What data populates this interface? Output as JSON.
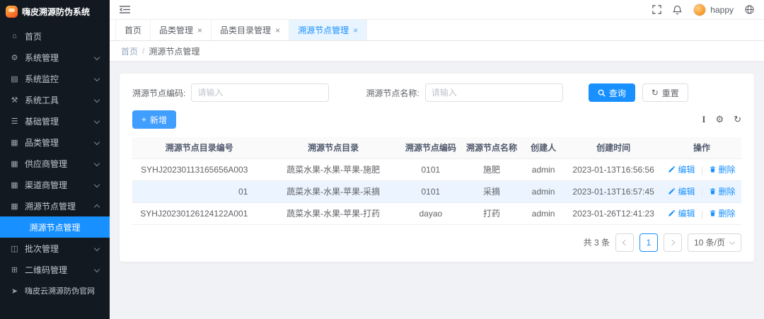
{
  "app": {
    "title": "嗨皮溯源防伪系统",
    "accent_color": "#1890ff",
    "sidebar_bg": "#131920"
  },
  "topbar": {
    "username": "happy"
  },
  "icons": {
    "plus": "+",
    "gear": "⚙",
    "refresh": "↻",
    "size": "I",
    "close": "×"
  },
  "sidebar": {
    "items": [
      {
        "label": "首页",
        "icon": "home-icon",
        "glyph": "⌂"
      },
      {
        "label": "系统管理",
        "icon": "gear-icon",
        "glyph": "⚙"
      },
      {
        "label": "系统监控",
        "icon": "monitor-icon",
        "glyph": "▤"
      },
      {
        "label": "系统工具",
        "icon": "tools-icon",
        "glyph": "⚒"
      },
      {
        "label": "基础管理",
        "icon": "list-icon",
        "glyph": "☰"
      },
      {
        "label": "品类管理",
        "icon": "grid-icon",
        "glyph": "▦"
      },
      {
        "label": "供应商管理",
        "icon": "grid-icon",
        "glyph": "▦"
      },
      {
        "label": "渠道商管理",
        "icon": "grid-icon",
        "glyph": "▦"
      },
      {
        "label": "溯源节点管理",
        "icon": "grid-icon",
        "glyph": "▦",
        "children": [
          {
            "label": "溯源节点管理"
          }
        ]
      },
      {
        "label": "批次管理",
        "icon": "batch-icon",
        "glyph": "◫"
      },
      {
        "label": "二维码管理",
        "icon": "qrcode-icon",
        "glyph": "⊞"
      },
      {
        "label": "嗨皮云溯源防伪官网",
        "icon": "send-icon",
        "glyph": "➤"
      }
    ]
  },
  "tabs": [
    {
      "label": "首页"
    },
    {
      "label": "品类管理"
    },
    {
      "label": "品类目录管理"
    },
    {
      "label": "溯源节点管理"
    }
  ],
  "breadcrumb": {
    "first": "首页",
    "separator": "/",
    "last": "溯源节点管理"
  },
  "search": {
    "code_label": "溯源节点编码:",
    "code_placeholder": "请输入",
    "name_label": "溯源节点名称:",
    "name_placeholder": "请输入",
    "search_button": "查询",
    "reset_button": "重置"
  },
  "toolbar": {
    "add_button": "新增"
  },
  "table": {
    "headers": [
      "溯源节点目录编号",
      "溯源节点目录",
      "溯源节点编码",
      "溯源节点名称",
      "创建人",
      "创建时间",
      "操作"
    ],
    "rows": [
      [
        "SYHJ20230113165656A003",
        "蔬菜水果-水果-苹果-施肥",
        "0101",
        "施肥",
        "admin",
        "2023-01-13T16:56:56"
      ],
      [
        "01",
        "蔬菜水果-水果-苹果-采摘",
        "0101",
        "采摘",
        "admin",
        "2023-01-13T16:57:45"
      ],
      [
        "SYHJ20230126124122A001",
        "蔬菜水果-水果-苹果-打药",
        "dayao",
        "打药",
        "admin",
        "2023-01-26T12:41:23"
      ]
    ],
    "actions": {
      "edit": "编辑",
      "delete": "删除"
    }
  },
  "pagination": {
    "total": "共 3 条",
    "current_page": "1",
    "page_size": "10 条/页"
  }
}
